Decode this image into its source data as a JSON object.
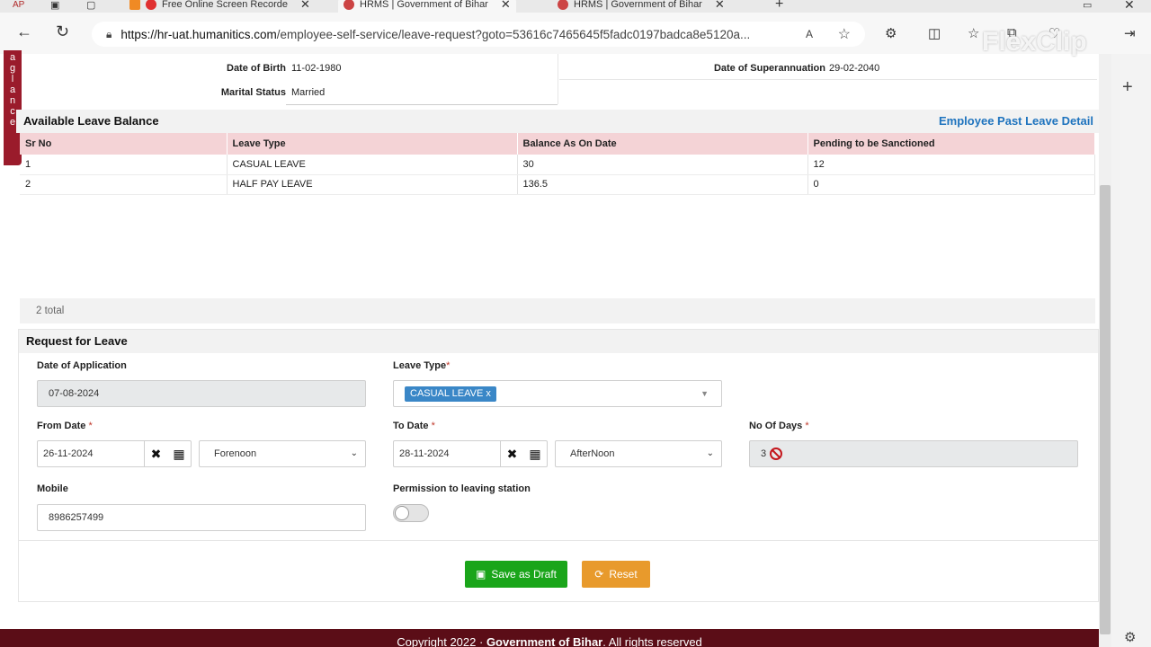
{
  "browser": {
    "tabs": [
      {
        "label": "Free Online Screen Recorde"
      },
      {
        "label": "HRMS | Government of Bihar"
      },
      {
        "label": "HRMS | Government of Bihar"
      }
    ],
    "profile_badge": "AP",
    "url_host": "https://hr-uat.humanitics.com",
    "url_path": "/employee-self-service/leave-request?goto=53616c7465645f5fadc0197badca8e5120a..."
  },
  "watermark": "FlexClip",
  "left_tab": [
    "a",
    "g",
    "l",
    "a",
    "n",
    "c",
    "e"
  ],
  "employee_info": {
    "dob_label": "Date of Birth",
    "dob": "11-02-1980",
    "marital_label": "Marital Status",
    "marital": "Married",
    "superannuation_label": "Date of Superannuation",
    "superannuation": "29-02-2040"
  },
  "leave_balance": {
    "title": "Available Leave Balance",
    "past_link": "Employee Past Leave Detail",
    "columns": [
      "Sr No",
      "Leave Type",
      "Balance As On Date",
      "Pending to be Sanctioned"
    ],
    "rows": [
      [
        "1",
        "CASUAL LEAVE",
        "30",
        "12"
      ],
      [
        "2",
        "HALF PAY LEAVE",
        "136.5",
        "0"
      ]
    ],
    "total": "2 total"
  },
  "request": {
    "title": "Request for Leave",
    "date_of_application_label": "Date of Application",
    "date_of_application": "07-08-2024",
    "leave_type_label": "Leave Type",
    "leave_type_chip": "CASUAL LEAVE",
    "chip_remove": "x",
    "from_date_label": "From Date",
    "from_date": "26-11-2024",
    "from_session": "Forenoon",
    "to_date_label": "To Date",
    "to_date": "28-11-2024",
    "to_session": "AfterNoon",
    "days_label": "No Of Days",
    "days": "3",
    "mobile_label": "Mobile",
    "mobile": "8986257499",
    "permission_label": "Permission to leaving station",
    "permission_on": false,
    "required_mark": "*"
  },
  "actions": {
    "save_draft": "Save as Draft",
    "reset": "Reset",
    "save_color": "#1aa51a",
    "reset_color": "#e89a2c"
  },
  "footer": {
    "prefix": "Copyright 2022 · ",
    "org": "Government of Bihar",
    "suffix": ". All rights reserved"
  }
}
